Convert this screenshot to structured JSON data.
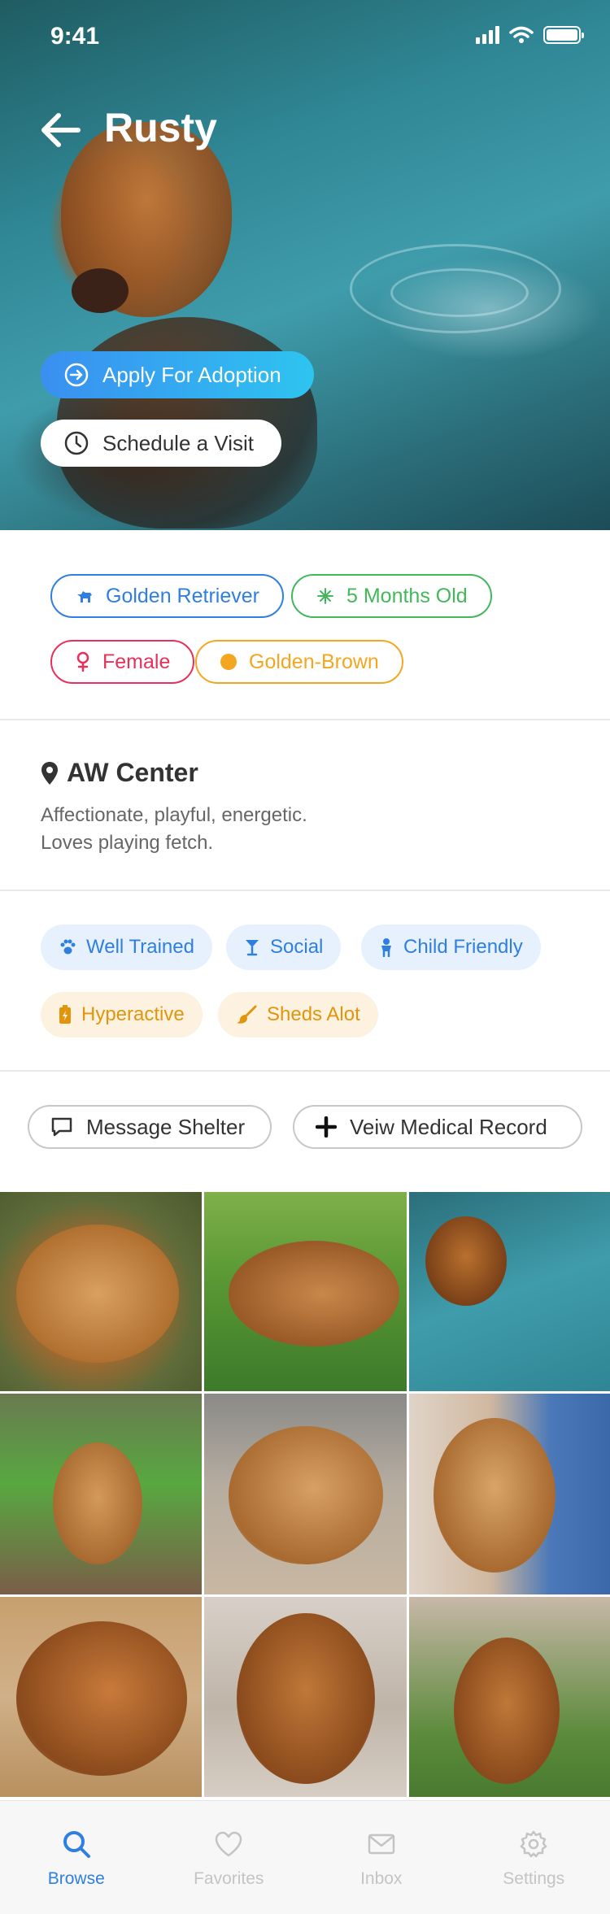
{
  "status_bar": {
    "time": "9:41"
  },
  "header": {
    "pet_name": "Rusty"
  },
  "actions": {
    "apply_label": "Apply For Adoption",
    "visit_label": "Schedule a Visit"
  },
  "attributes": [
    {
      "label": "Golden Retriever",
      "icon": "dog-icon",
      "color": "#2f7fe0"
    },
    {
      "label": "5 Months Old",
      "icon": "sparkle-icon",
      "color": "#43b85a"
    },
    {
      "label": "Female",
      "icon": "female-icon",
      "color": "#e8305a"
    },
    {
      "label": "Golden-Brown",
      "icon": "color-dot-icon",
      "color": "#f4a620"
    }
  ],
  "location": {
    "name": "AW Center",
    "description_line1": "Affectionate, playful, energetic.",
    "description_line2": "Loves playing fetch."
  },
  "traits": [
    {
      "label": "Well Trained",
      "icon": "paw-icon",
      "color": "#2f7fe0"
    },
    {
      "label": "Social",
      "icon": "cocktail-icon",
      "color": "#2f7fe0"
    },
    {
      "label": "Child Friendly",
      "icon": "baby-icon",
      "color": "#2f7fe0"
    },
    {
      "label": "Hyperactive",
      "icon": "battery-icon",
      "color": "#e0950c"
    },
    {
      "label": "Sheds Alot",
      "icon": "brush-icon",
      "color": "#e0950c"
    }
  ],
  "contact": {
    "message_label": "Message Shelter",
    "medical_label": "Veiw Medical Record"
  },
  "gallery": {
    "photo_count": 9
  },
  "tabbar": [
    {
      "label": "Browse",
      "icon": "search-icon",
      "active": true
    },
    {
      "label": "Favorites",
      "icon": "heart-icon",
      "active": false
    },
    {
      "label": "Inbox",
      "icon": "mail-icon",
      "active": false
    },
    {
      "label": "Settings",
      "icon": "gear-icon",
      "active": false
    }
  ],
  "colors": {
    "accent": "#2f7fe0",
    "green": "#43b85a",
    "pink": "#e8305a",
    "orange": "#f4a620"
  }
}
